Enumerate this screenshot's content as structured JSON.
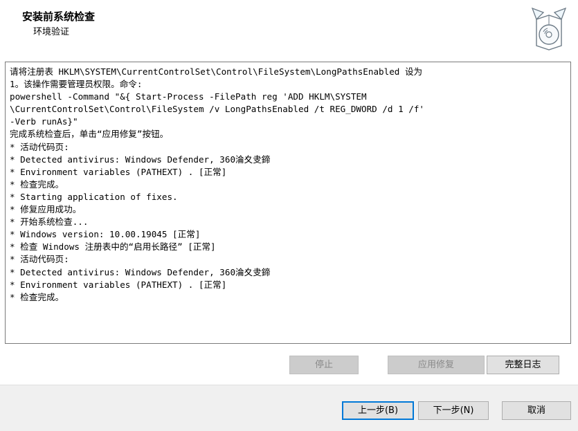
{
  "header": {
    "title": "安装前系统检查",
    "subtitle": "环境验证",
    "logo_icon": "install-box-cd-icon"
  },
  "log": {
    "lines": [
      "请将注册表 HKLM\\SYSTEM\\CurrentControlSet\\Control\\FileSystem\\LongPathsEnabled 设为",
      "1。该操作需要管理员权限。命令:",
      "powershell -Command \"&{ Start-Process -FilePath reg 'ADD HKLM\\SYSTEM",
      "\\CurrentControlSet\\Control\\FileSystem /v LongPathsEnabled /t REG_DWORD /d 1 /f'",
      "-Verb runAs}\"",
      "完成系统检查后，单击“应用修复”按钮。",
      "* 活动代码页:",
      "* Detected antivirus: Windows Defender, 360淪夊叏鍗",
      "* Environment variables (PATHEXT) . [正常]",
      "* 检查完成。",
      "* Starting application of fixes.",
      "* 修复应用成功。",
      "* 开始系统检查...",
      "* Windows version: 10.00.19045 [正常]",
      "* 检查 Windows 注册表中的“启用长路径” [正常]",
      "* 活动代码页:",
      "* Detected antivirus: Windows Defender, 360淪夊叏鍗",
      "* Environment variables (PATHEXT) . [正常]",
      "* 检查完成。"
    ]
  },
  "actions": {
    "stop": "停止",
    "apply_fix": "应用修复",
    "full_log": "完整日志"
  },
  "footer": {
    "back": "上一步(B)",
    "next": "下一步(N)",
    "cancel": "取消"
  },
  "colors": {
    "focus_border": "#0078d7",
    "footer_bg": "#f0f0f0"
  }
}
